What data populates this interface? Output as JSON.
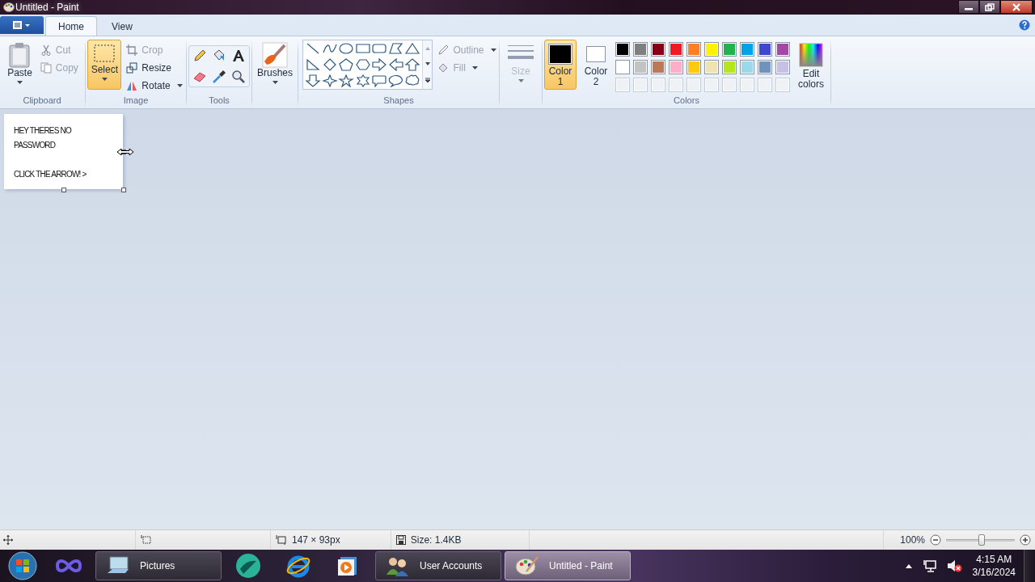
{
  "window": {
    "title": "Untitled - Paint"
  },
  "ribbon_tabs": [
    {
      "label": "Home",
      "selected": true
    },
    {
      "label": "View",
      "selected": false
    }
  ],
  "clipboard": {
    "label": "Clipboard",
    "paste": "Paste",
    "items": [
      {
        "label": "Cut",
        "disabled": true
      },
      {
        "label": "Copy",
        "disabled": true
      }
    ]
  },
  "image": {
    "label": "Image",
    "select": {
      "label": "Select",
      "selected": true
    },
    "items": [
      {
        "label": "Crop",
        "disabled": true
      },
      {
        "label": "Resize",
        "disabled": false
      },
      {
        "label": "Rotate",
        "disabled": false
      }
    ]
  },
  "tools": {
    "label": "Tools"
  },
  "brushes": {
    "label": "Brushes"
  },
  "shapes": {
    "label": "Shapes",
    "outline": {
      "label": "Outline",
      "disabled": true
    },
    "fill": {
      "label": "Fill",
      "disabled": true
    }
  },
  "size": {
    "label": "Size",
    "disabled": true
  },
  "colors": {
    "label": "Colors",
    "color1": {
      "label": "Color 1",
      "color": "#000000",
      "selected": true
    },
    "color2": {
      "label": "Color 2",
      "color": "#ffffff",
      "selected": false
    },
    "palette": [
      {
        "color": "#000000"
      },
      {
        "color": "#7f7f7f"
      },
      {
        "color": "#880015"
      },
      {
        "color": "#ed1c24"
      },
      {
        "color": "#ff7f27"
      },
      {
        "color": "#fff200"
      },
      {
        "color": "#22b14c"
      },
      {
        "color": "#00a2e8"
      },
      {
        "color": "#3f48cc"
      },
      {
        "color": "#a349a4"
      },
      {
        "color": "#ffffff"
      },
      {
        "color": "#c3c3c3"
      },
      {
        "color": "#b97a57"
      },
      {
        "color": "#ffaec9"
      },
      {
        "color": "#ffc90e"
      },
      {
        "color": "#efe4b0"
      },
      {
        "color": "#b5e61d"
      },
      {
        "color": "#99d9ea"
      },
      {
        "color": "#7092be"
      },
      {
        "color": "#c8bfe7"
      }
    ],
    "edit": "Edit colors"
  },
  "canvas": {
    "paragraphs": [
      [
        "HEY THERES NO",
        "PASSWORD"
      ],
      [
        "CLICK THE ARROW! >"
      ]
    ]
  },
  "status_bar": {
    "dimensions": "147 × 93px",
    "size": "Size: 1.4KB",
    "zoom": "100%",
    "zoom_slider": {
      "level": 0.52
    }
  },
  "taskbar": {
    "items": [
      {
        "kind": "pinned"
      },
      {
        "kind": "window",
        "label": "Pictures",
        "selected": false
      },
      {
        "kind": "pinned"
      },
      {
        "kind": "pinned"
      },
      {
        "kind": "pinned"
      },
      {
        "kind": "window",
        "label": "User Accounts",
        "selected": false
      },
      {
        "kind": "window",
        "label": "Untitled - Paint",
        "selected": true
      }
    ],
    "time": "4:15 AM",
    "date": "3/16/2024"
  }
}
